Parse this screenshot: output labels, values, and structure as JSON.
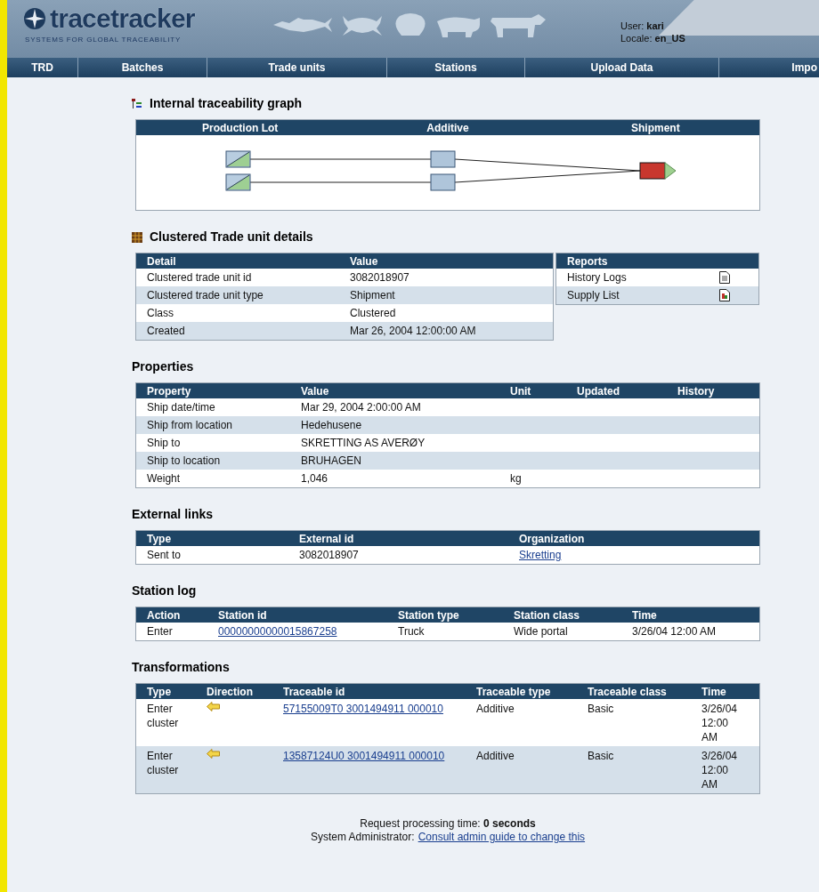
{
  "header": {
    "logo": "tracetracker",
    "tagline": "SYSTEMS FOR GLOBAL TRACEABILITY",
    "user_label": "User:",
    "user": "kari",
    "locale_label": "Locale:",
    "locale": "en_US"
  },
  "nav": [
    {
      "label": "TRD"
    },
    {
      "label": "Batches"
    },
    {
      "label": "Trade units"
    },
    {
      "label": "Stations"
    },
    {
      "label": "Upload Data"
    },
    {
      "label": "Impo"
    }
  ],
  "graph": {
    "title": "Internal traceability graph",
    "columns": [
      "Production Lot",
      "Additive",
      "Shipment"
    ]
  },
  "details": {
    "title": "Clustered Trade unit details",
    "columns": [
      "Detail",
      "Value"
    ],
    "rows": [
      [
        "Clustered trade unit id",
        "3082018907"
      ],
      [
        "Clustered trade unit type",
        "Shipment"
      ],
      [
        "Class",
        "Clustered"
      ],
      [
        "Created",
        "Mar 26, 2004 12:00:00 AM"
      ]
    ]
  },
  "reports": {
    "title": "Reports",
    "items": [
      {
        "label": "History Logs",
        "kind": "document"
      },
      {
        "label": "Supply List",
        "kind": "chart"
      }
    ]
  },
  "properties": {
    "title": "Properties",
    "columns": [
      "Property",
      "Value",
      "Unit",
      "Updated",
      "History"
    ],
    "rows": [
      [
        "Ship date/time",
        "Mar 29, 2004 2:00:00 AM"
      ],
      [
        "Ship from location",
        "Hedehusene"
      ],
      [
        "Ship to",
        "SKRETTING AS AVERØY"
      ],
      [
        "Ship to location",
        "BRUHAGEN"
      ],
      [
        "Weight",
        "1,046",
        "kg"
      ]
    ]
  },
  "external_links": {
    "title": "External links",
    "columns": [
      "Type",
      "External id",
      "Organization"
    ],
    "rows": [
      {
        "type": "Sent to",
        "external_id": "3082018907",
        "organization": "Skretting"
      }
    ]
  },
  "station_log": {
    "title": "Station log",
    "columns": [
      "Action",
      "Station id",
      "Station type",
      "Station class",
      "Time"
    ],
    "rows": [
      {
        "action": "Enter",
        "station_id": "00000000000015867258",
        "station_type": "Truck",
        "station_class": "Wide portal",
        "time": "3/26/04 12:00 AM"
      }
    ]
  },
  "transformations": {
    "title": "Transformations",
    "columns": [
      "Type",
      "Direction",
      "Traceable id",
      "Traceable type",
      "Traceable class",
      "Time"
    ],
    "rows": [
      {
        "type": "Enter cluster",
        "traceable_id": "57155009T0 3001494911 000010",
        "traceable_type": "Additive",
        "traceable_class": "Basic",
        "time": "3/26/04 12:00 AM"
      },
      {
        "type": "Enter cluster",
        "traceable_id": "13587124U0 3001494911 000010",
        "traceable_type": "Additive",
        "traceable_class": "Basic",
        "time": "3/26/04 12:00 AM"
      }
    ]
  },
  "footer": {
    "processing": "Request processing time: **0 seconds**",
    "admin_label": "System Administrator:",
    "admin_link": "Consult admin guide to change this"
  }
}
